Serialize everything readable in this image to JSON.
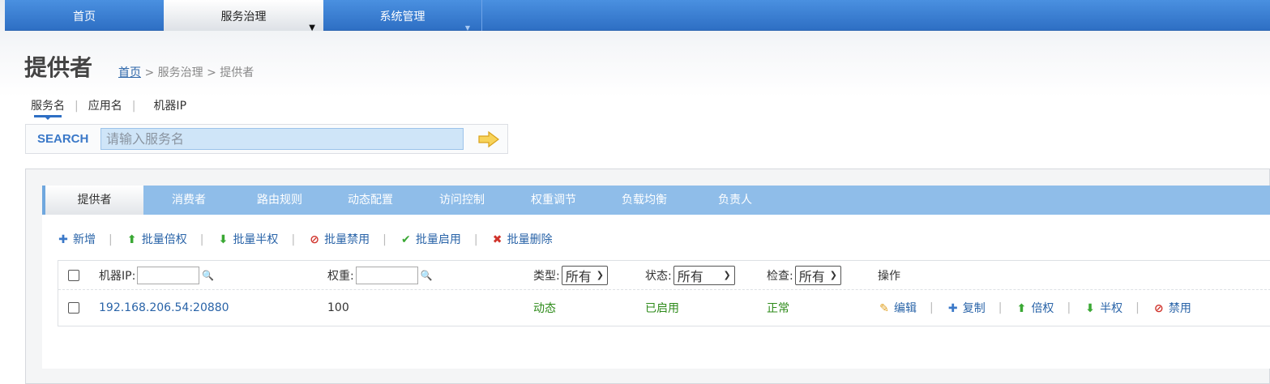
{
  "topnav": {
    "home": "首页",
    "service_governance": "服务治理",
    "system_management": "系统管理"
  },
  "page": {
    "title": "提供者",
    "breadcrumb_home": "首页",
    "breadcrumb_rest": " > 服务治理 > 提供者"
  },
  "search": {
    "tabs": [
      "服务名",
      "应用名",
      "机器IP"
    ],
    "label": "SEARCH",
    "placeholder": "请输入服务名"
  },
  "main_tabs": [
    "提供者",
    "消费者",
    "路由规则",
    "动态配置",
    "访问控制",
    "权重调节",
    "负载均衡",
    "负责人"
  ],
  "toolbar": {
    "add": "新增",
    "batch_double": "批量倍权",
    "batch_half": "批量半权",
    "batch_disable": "批量禁用",
    "batch_enable": "批量启用",
    "batch_delete": "批量删除"
  },
  "table": {
    "header": {
      "ip_label": "机器IP:",
      "weight_label": "权重:",
      "type_label": "类型:",
      "type_value": "所有",
      "status_label": "状态:",
      "status_value": "所有",
      "check_label": "检查:",
      "check_value": "所有",
      "ops_label": "操作"
    },
    "rows": [
      {
        "address": "192.168.206.54:20880",
        "weight": "100",
        "type": "动态",
        "status": "已启用",
        "check": "正常",
        "ops": [
          "编辑",
          "复制",
          "倍权",
          "半权",
          "禁用"
        ]
      }
    ]
  },
  "colors": {
    "nav_blue": "#2e6fc4",
    "tab_blue": "#8fbde9",
    "link_blue": "#2a64a8",
    "ok_green": "#2e8b1a"
  }
}
